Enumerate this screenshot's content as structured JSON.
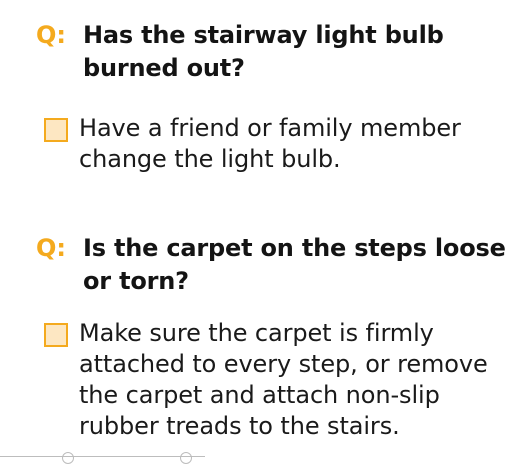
{
  "questions": [
    {
      "marker": "Q:",
      "question": "Has the stairway light bulb burned out?",
      "answer": "Have a friend or family member change the light bulb."
    },
    {
      "marker": "Q:",
      "question": "Is the carpet on the steps loose or torn?",
      "answer": "Make sure the carpet is firmly attached to every step, or remove the carpet and attach non-slip rubber treads to the stairs."
    }
  ],
  "colors": {
    "accent": "#f4aa1e",
    "checkbox_fill": "#fde7c2",
    "text": "#1a1a1a"
  },
  "icons": {
    "checkbox": "empty-checkbox-icon"
  }
}
